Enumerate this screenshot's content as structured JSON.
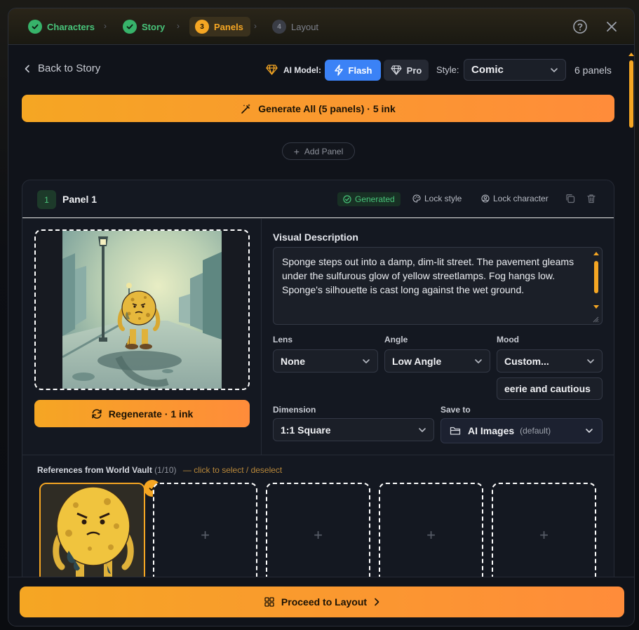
{
  "stepper": {
    "steps": [
      {
        "label": "Characters",
        "status": "done"
      },
      {
        "label": "Story",
        "status": "done"
      },
      {
        "label": "Panels",
        "number": "3",
        "status": "active"
      },
      {
        "label": "Layout",
        "number": "4",
        "status": "todo"
      }
    ]
  },
  "toolbar": {
    "back_label": "Back to Story",
    "model_label": "AI Model:",
    "flash_label": "Flash",
    "pro_label": "Pro",
    "style_label": "Style:",
    "style_value": "Comic",
    "panel_count": "6 panels"
  },
  "generate_all_label": "Generate All (5 panels) · 5 ink",
  "add_panel_label": "Add Panel",
  "panel": {
    "number": "1",
    "title": "Panel 1",
    "status_badge": "Generated",
    "lock_style_label": "Lock style",
    "lock_character_label": "Lock character",
    "regenerate_label": "Regenerate · 1 ink",
    "visual_description_label": "Visual Description",
    "visual_description": "Sponge steps out into a damp, dim-lit street. The pavement gleams under the sulfurous glow of yellow streetlamps. Fog hangs low. Sponge's silhouette is cast long against the wet ground.",
    "lens_label": "Lens",
    "lens_value": "None",
    "angle_label": "Angle",
    "angle_value": "Low Angle",
    "mood_label": "Mood",
    "mood_value": "Custom...",
    "mood_custom": "eerie and cautious",
    "dimension_label": "Dimension",
    "dimension_value": "1:1 Square",
    "save_to_label": "Save to",
    "save_to_value": "AI Images",
    "save_to_default": "(default)"
  },
  "references": {
    "title": "References from World Vault",
    "count": "(1/10)",
    "hint": "— click to select / deselect"
  },
  "footer": {
    "proceed_label": "Proceed to Layout"
  },
  "colors": {
    "accent": "#f5a623",
    "accent_end": "#ff8c3a",
    "success": "#48c47a",
    "flash_blue": "#3b82f6",
    "background": "#10131a"
  }
}
